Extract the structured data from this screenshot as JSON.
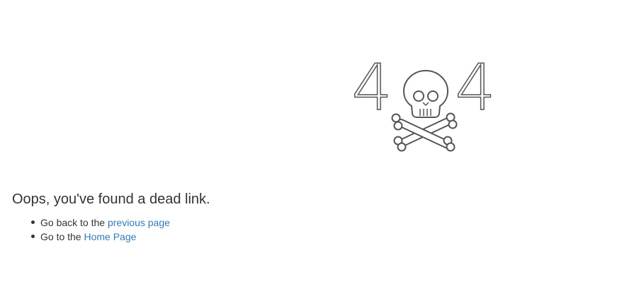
{
  "error_art": {
    "digit_left": "4",
    "digit_right": "4",
    "skull_icon": "skull-crossbones-icon",
    "stroke_color": "#555555"
  },
  "message": "Oops, you've found a dead link.",
  "options": [
    {
      "prefix": "Go back to the",
      "link_label": "previous page"
    },
    {
      "prefix": "Go to the",
      "link_label": "Home Page"
    }
  ],
  "colors": {
    "text": "#333333",
    "link": "#337ab7",
    "background": "#ffffff"
  }
}
